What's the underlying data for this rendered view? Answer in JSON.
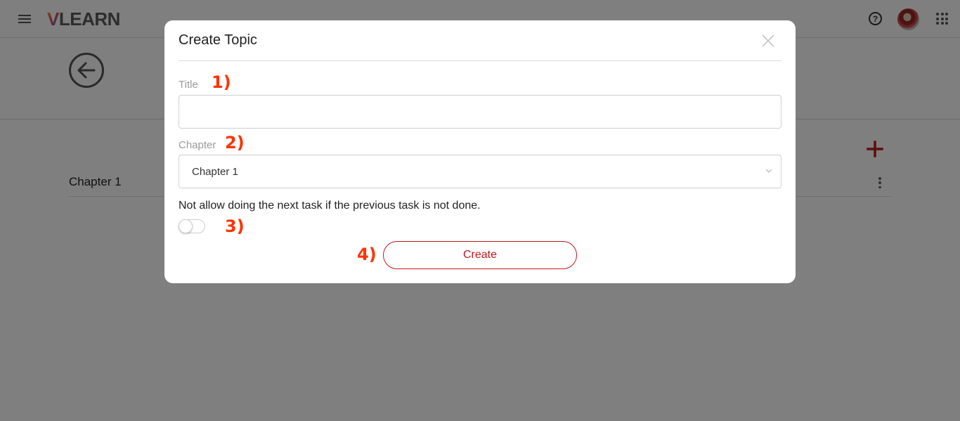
{
  "header": {
    "logo_v": "V",
    "logo_rest": "LEARN"
  },
  "content": {
    "chapter_title": "Chapter 1"
  },
  "modal": {
    "title": "Create Topic",
    "title_label": "Title",
    "title_value": "",
    "chapter_label": "Chapter",
    "chapter_value": "Chapter 1",
    "toggle_label": "Not allow doing the next task if the previous task is not done.",
    "toggle_on": false,
    "create_label": "Create"
  },
  "annotations": {
    "step1": "1)",
    "step2": "2)",
    "step3": "3)",
    "step4": "4)"
  },
  "colors": {
    "accent": "#c0181a",
    "annotation": "#ff3300",
    "overlay": "rgba(0,0,0,0.5)"
  }
}
